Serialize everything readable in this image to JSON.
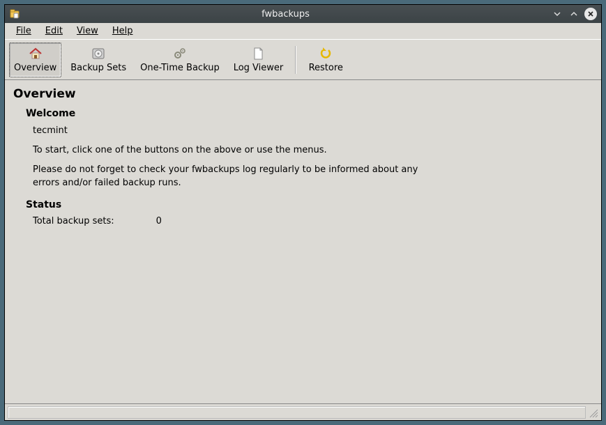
{
  "window": {
    "title": "fwbackups"
  },
  "menubar": {
    "file": "File",
    "edit": "Edit",
    "view": "View",
    "help": "Help"
  },
  "toolbar": {
    "overview": "Overview",
    "backup_sets": "Backup Sets",
    "one_time_backup": "One-Time Backup",
    "log_viewer": "Log Viewer",
    "restore": "Restore"
  },
  "content": {
    "page_title": "Overview",
    "welcome_heading": "Welcome",
    "username": "tecmint",
    "intro_line": "To start, click one of the buttons on the above or use the menus.",
    "reminder_line": "Please do not forget to check your fwbackups log regularly to be informed about any errors and/or failed backup runs.",
    "status_heading": "Status",
    "total_backup_sets_label": "Total backup sets:",
    "total_backup_sets_value": "0"
  },
  "statusbar": {
    "text": ""
  }
}
